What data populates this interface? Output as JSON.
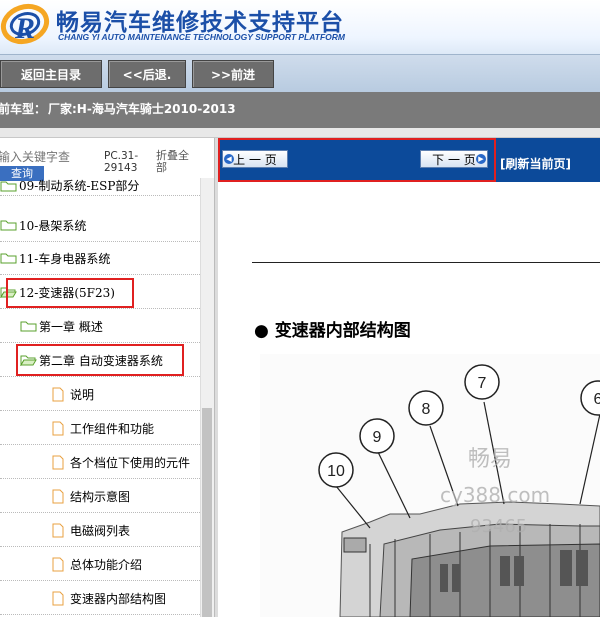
{
  "header": {
    "title_cn": "畅易汽车维修技术支持平台",
    "title_en": "CHANG YI AUTO MAINTENANCE TECHNOLOGY SUPPORT PLATFORM",
    "logo_icon": "cy-swirl-logo",
    "colors": {
      "brand_blue": "#1b4fa8",
      "accent_orange": "#f5a623"
    }
  },
  "nav": {
    "home_label": "返回主目录",
    "back_label": "<<后退.",
    "forward_label": ">>前进"
  },
  "model_bar": {
    "prefix": "前车型：",
    "value": "厂家:H-海马汽车骑士2010-2013"
  },
  "sidebar": {
    "search_placeholder": "输入关键字查",
    "search_button": "查询",
    "pc_text": "PC.31-29143",
    "collapse_text": "折叠全部",
    "tree": [
      {
        "label": "09-制动系统-ESP部分",
        "icon": "folder-icon",
        "level": 0
      },
      {
        "label": "10-悬架系统",
        "icon": "folder-icon",
        "level": 0
      },
      {
        "label": "11-车身电器系统",
        "icon": "folder-icon",
        "level": 0
      },
      {
        "label": "12-变速器(5F23)",
        "icon": "folder-open-icon",
        "level": 0
      },
      {
        "label": "第一章 概述",
        "icon": "folder-icon",
        "level": 1
      },
      {
        "label": "第二章 自动变速器系统",
        "icon": "folder-open-icon",
        "level": 1
      },
      {
        "label": "说明",
        "icon": "document-icon",
        "level": 2
      },
      {
        "label": "工作组件和功能",
        "icon": "document-icon",
        "level": 2
      },
      {
        "label": "各个档位下使用的元件",
        "icon": "document-icon",
        "level": 2
      },
      {
        "label": "结构示意图",
        "icon": "document-icon",
        "level": 2
      },
      {
        "label": "电磁阀列表",
        "icon": "document-icon",
        "level": 2
      },
      {
        "label": "总体功能介绍",
        "icon": "document-icon",
        "level": 2
      },
      {
        "label": "变速器内部结构图",
        "icon": "document-icon",
        "level": 2
      }
    ]
  },
  "content": {
    "prev_label": "上 一 页",
    "next_label": "下 一 页",
    "refresh_label": "[刷新当前页]",
    "heading": "● 变速器内部结构图",
    "callouts": [
      "10",
      "9",
      "8",
      "7",
      "6"
    ],
    "watermark": [
      "畅易",
      "cy388.com",
      "93465"
    ],
    "colors": {
      "content_bar": "#0c4a9a",
      "highlight_red": "#e02020"
    }
  }
}
